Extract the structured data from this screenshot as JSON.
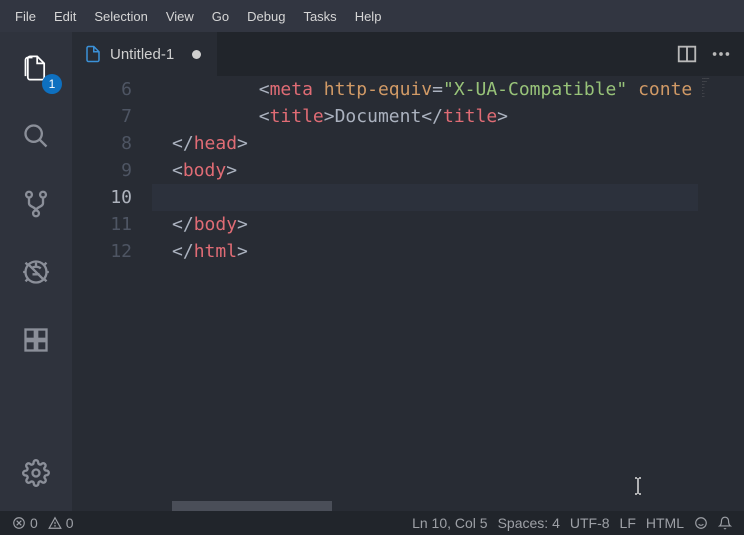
{
  "menu": [
    "File",
    "Edit",
    "Selection",
    "View",
    "Go",
    "Debug",
    "Tasks",
    "Help"
  ],
  "activity": {
    "explorer_badge": "1"
  },
  "tab": {
    "filename": "Untitled-1"
  },
  "editor": {
    "lines": [
      {
        "num": "6",
        "indent": 4,
        "tokens": [
          [
            "punc",
            "<"
          ],
          [
            "tagname",
            "meta"
          ],
          [
            "punc",
            " "
          ],
          [
            "attr",
            "http-equiv"
          ],
          [
            "punc",
            "="
          ],
          [
            "string",
            "\"X-UA-Compatible\""
          ],
          [
            "punc",
            " "
          ],
          [
            "attr",
            "conte"
          ]
        ]
      },
      {
        "num": "7",
        "indent": 4,
        "tokens": [
          [
            "punc",
            "<"
          ],
          [
            "tagname",
            "title"
          ],
          [
            "punc",
            ">"
          ],
          [
            "text",
            "Document"
          ],
          [
            "punc",
            "</"
          ],
          [
            "tagname",
            "title"
          ],
          [
            "punc",
            ">"
          ]
        ]
      },
      {
        "num": "8",
        "indent": 0,
        "tokens": [
          [
            "punc",
            "</"
          ],
          [
            "tagname",
            "head"
          ],
          [
            "punc",
            ">"
          ]
        ]
      },
      {
        "num": "9",
        "indent": 0,
        "tokens": [
          [
            "punc",
            "<"
          ],
          [
            "tagname",
            "body"
          ],
          [
            "punc",
            ">"
          ]
        ]
      },
      {
        "num": "10",
        "indent": 0,
        "tokens": [],
        "current": true
      },
      {
        "num": "11",
        "indent": 0,
        "tokens": [
          [
            "punc",
            "</"
          ],
          [
            "tagname",
            "body"
          ],
          [
            "punc",
            ">"
          ]
        ]
      },
      {
        "num": "12",
        "indent": 0,
        "tokens": [
          [
            "punc",
            "</"
          ],
          [
            "tagname",
            "html"
          ],
          [
            "punc",
            ">"
          ]
        ]
      }
    ]
  },
  "status": {
    "errors": "0",
    "warnings": "0",
    "ln_col": "Ln 10, Col 5",
    "spaces": "Spaces: 4",
    "encoding": "UTF-8",
    "eol": "LF",
    "language": "HTML"
  }
}
